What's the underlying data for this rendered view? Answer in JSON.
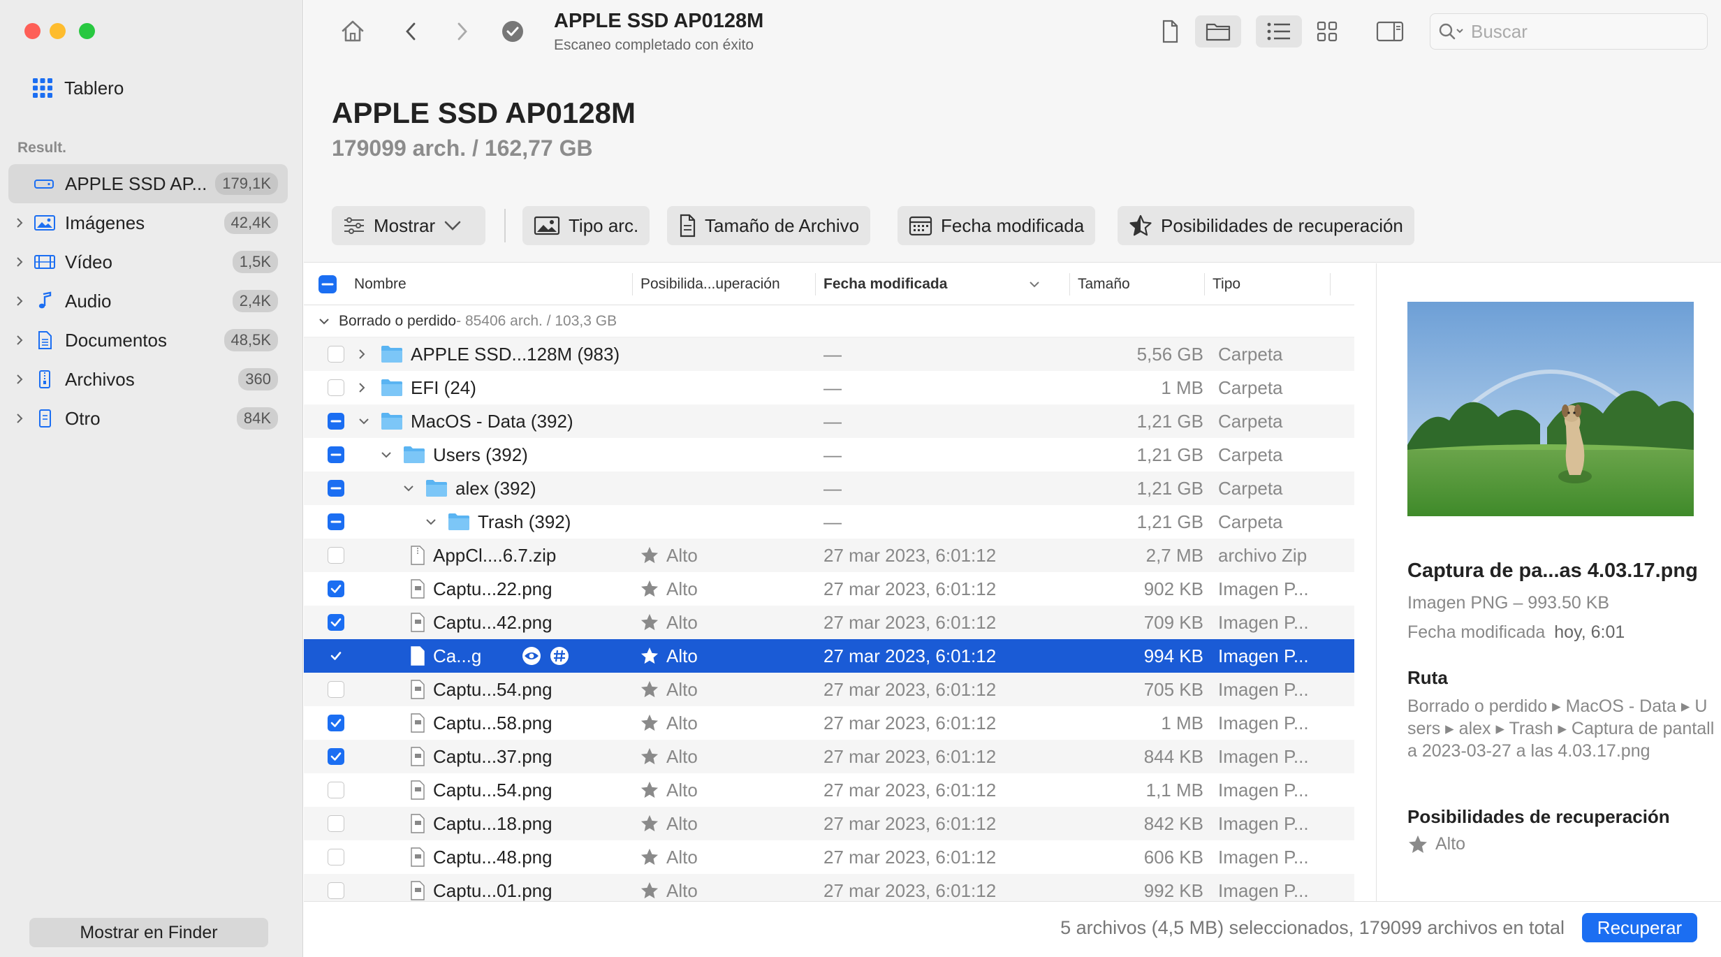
{
  "sidebar": {
    "dashboard_label": "Tablero",
    "section_label": "Result.",
    "items": [
      {
        "label": "APPLE SSD AP...",
        "count": "179,1K",
        "icon": "drive-icon"
      },
      {
        "label": "Imágenes",
        "count": "42,4K",
        "icon": "image-icon"
      },
      {
        "label": "Vídeo",
        "count": "1,5K",
        "icon": "film-icon"
      },
      {
        "label": "Audio",
        "count": "2,4K",
        "icon": "music-note-icon"
      },
      {
        "label": "Documentos",
        "count": "48,5K",
        "icon": "document-icon"
      },
      {
        "label": "Archivos",
        "count": "360",
        "icon": "archive-icon"
      },
      {
        "label": "Otro",
        "count": "84K",
        "icon": "other-file-icon"
      }
    ],
    "show_finder_label": "Mostrar en Finder"
  },
  "toolbar": {
    "title": "APPLE SSD AP0128M",
    "subtitle": "Escaneo completado con éxito",
    "search_placeholder": "Buscar"
  },
  "header": {
    "title": "APPLE SSD AP0128M",
    "subtitle": "179099 arch. / 162,77 GB",
    "filters": {
      "show": "Mostrar",
      "file_type": "Tipo arc.",
      "file_size": "Tamaño de Archivo",
      "date_modified": "Fecha modificada",
      "recovery_chances": "Posibilidades de recuperación"
    }
  },
  "table": {
    "columns": {
      "name": "Nombre",
      "recovery": "Posibilida...uperación",
      "date": "Fecha modificada",
      "size": "Tamaño",
      "type": "Tipo"
    },
    "group": {
      "label": "Borrado o perdido",
      "summary": " - 85406 arch. / 103,3 GB"
    },
    "rows": [
      {
        "level": 0,
        "expander": "collapsed",
        "check": "off",
        "kind": "folder",
        "name": "APPLE SSD...128M (983)",
        "recovery": "",
        "date": "—",
        "size": "5,56 GB",
        "type": "Carpeta"
      },
      {
        "level": 0,
        "expander": "collapsed",
        "check": "off",
        "kind": "folder",
        "name": "EFI (24)",
        "recovery": "",
        "date": "—",
        "size": "1 MB",
        "type": "Carpeta"
      },
      {
        "level": 0,
        "expander": "expanded",
        "check": "partial",
        "kind": "folder",
        "name": "MacOS - Data (392)",
        "recovery": "",
        "date": "—",
        "size": "1,21 GB",
        "type": "Carpeta"
      },
      {
        "level": 1,
        "expander": "expanded",
        "check": "partial",
        "kind": "folder",
        "name": "Users (392)",
        "recovery": "",
        "date": "—",
        "size": "1,21 GB",
        "type": "Carpeta"
      },
      {
        "level": 2,
        "expander": "expanded",
        "check": "partial",
        "kind": "folder",
        "name": "alex (392)",
        "recovery": "",
        "date": "—",
        "size": "1,21 GB",
        "type": "Carpeta"
      },
      {
        "level": 3,
        "expander": "expanded",
        "check": "partial",
        "kind": "folder",
        "name": "Trash (392)",
        "recovery": "",
        "date": "—",
        "size": "1,21 GB",
        "type": "Carpeta"
      },
      {
        "level": 4,
        "expander": "none",
        "check": "off",
        "kind": "zip",
        "name": "AppCl....6.7.zip",
        "recovery": "Alto",
        "date": "27 mar 2023, 6:01:12",
        "size": "2,7 MB",
        "type": "archivo Zip"
      },
      {
        "level": 4,
        "expander": "none",
        "check": "on",
        "kind": "png",
        "name": "Captu...22.png",
        "recovery": "Alto",
        "date": "27 mar 2023, 6:01:12",
        "size": "902 KB",
        "type": "Imagen P..."
      },
      {
        "level": 4,
        "expander": "none",
        "check": "on",
        "kind": "png",
        "name": "Captu...42.png",
        "recovery": "Alto",
        "date": "27 mar 2023, 6:01:12",
        "size": "709 KB",
        "type": "Imagen P..."
      },
      {
        "level": 4,
        "expander": "none",
        "check": "on",
        "kind": "png",
        "name": "Ca...g",
        "recovery": "Alto",
        "date": "27 mar 2023, 6:01:12",
        "size": "994 KB",
        "type": "Imagen P...",
        "selected": true
      },
      {
        "level": 4,
        "expander": "none",
        "check": "off",
        "kind": "png",
        "name": "Captu...54.png",
        "recovery": "Alto",
        "date": "27 mar 2023, 6:01:12",
        "size": "705 KB",
        "type": "Imagen P..."
      },
      {
        "level": 4,
        "expander": "none",
        "check": "on",
        "kind": "png",
        "name": "Captu...58.png",
        "recovery": "Alto",
        "date": "27 mar 2023, 6:01:12",
        "size": "1 MB",
        "type": "Imagen P..."
      },
      {
        "level": 4,
        "expander": "none",
        "check": "on",
        "kind": "png",
        "name": "Captu...37.png",
        "recovery": "Alto",
        "date": "27 mar 2023, 6:01:12",
        "size": "844 KB",
        "type": "Imagen P..."
      },
      {
        "level": 4,
        "expander": "none",
        "check": "off",
        "kind": "png",
        "name": "Captu...54.png",
        "recovery": "Alto",
        "date": "27 mar 2023, 6:01:12",
        "size": "1,1 MB",
        "type": "Imagen P..."
      },
      {
        "level": 4,
        "expander": "none",
        "check": "off",
        "kind": "png",
        "name": "Captu...18.png",
        "recovery": "Alto",
        "date": "27 mar 2023, 6:01:12",
        "size": "842 KB",
        "type": "Imagen P..."
      },
      {
        "level": 4,
        "expander": "none",
        "check": "off",
        "kind": "png",
        "name": "Captu...48.png",
        "recovery": "Alto",
        "date": "27 mar 2023, 6:01:12",
        "size": "606 KB",
        "type": "Imagen P..."
      },
      {
        "level": 4,
        "expander": "none",
        "check": "off",
        "kind": "png",
        "name": "Captu...01.png",
        "recovery": "Alto",
        "date": "27 mar 2023, 6:01:12",
        "size": "992 KB",
        "type": "Imagen P..."
      }
    ]
  },
  "preview": {
    "file_name": "Captura de pa...as 4.03.17.png",
    "file_info": "Imagen PNG – 993.50 KB",
    "modified_label": "Fecha modificada",
    "modified_value": "hoy, 6:01",
    "path_heading": "Ruta",
    "path": "Borrado o perdido ▸ MacOS - Data ▸ Users ▸ alex ▸ Trash ▸ Captura de pantalla 2023-03-27 a las 4.03.17.png",
    "recovery_heading": "Posibilidades de recuperación",
    "recovery_value": "Alto"
  },
  "footer": {
    "status": "5 archivos (4,5 MB) seleccionados, 179099 archivos en total",
    "recover_label": "Recuperar"
  },
  "colors": {
    "accent": "#1b6ef2",
    "selection": "#1a5bd6",
    "folder": "#5ab4f2"
  }
}
